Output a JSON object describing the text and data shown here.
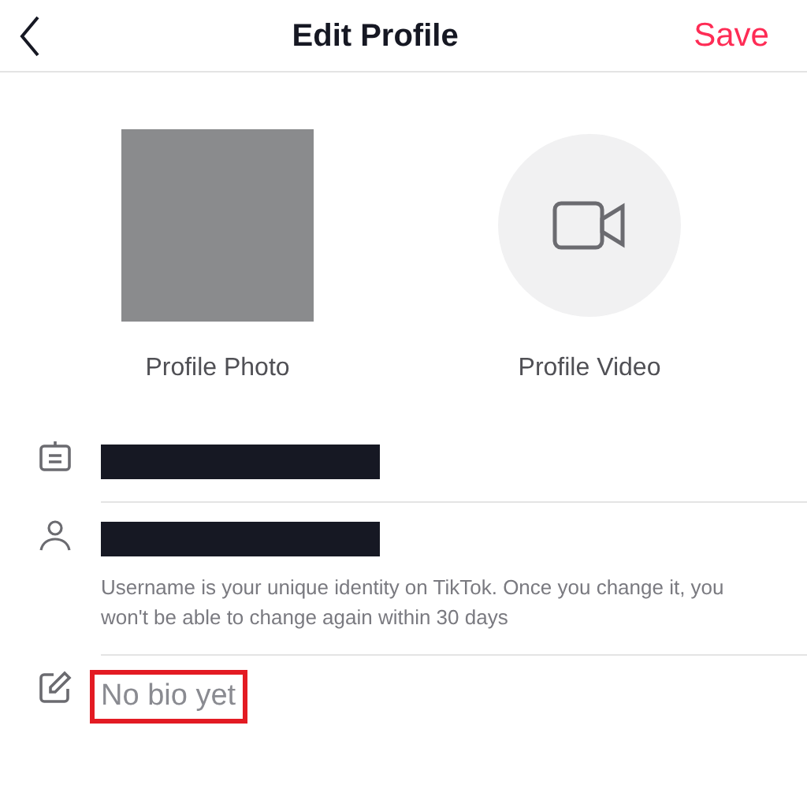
{
  "header": {
    "title": "Edit Profile",
    "save": "Save"
  },
  "media": [
    {
      "kind": "photo",
      "label": "Profile Photo"
    },
    {
      "kind": "video",
      "label": "Profile Video"
    }
  ],
  "fields": [
    {
      "kind": "name",
      "redacted": true
    },
    {
      "kind": "username",
      "redacted": true,
      "hint": "Username is your unique identity on TikTok. Once you change it, you won't be able to change again within 30 days"
    },
    {
      "kind": "bio",
      "placeholder": "No bio yet",
      "highlighted": true
    }
  ]
}
